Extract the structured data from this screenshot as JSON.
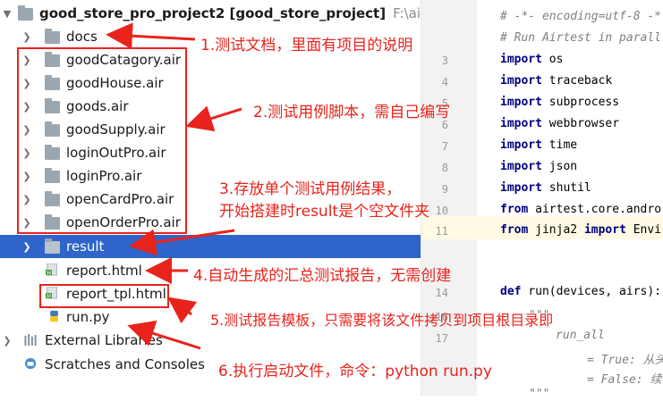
{
  "project": {
    "name": "good_store_pro_project2",
    "module": "[good_store_project]",
    "path": "F:\\airtest"
  },
  "tree": [
    {
      "label": "docs",
      "type": "folder"
    },
    {
      "label": "goodCatagory.air",
      "type": "folder"
    },
    {
      "label": "goodHouse.air",
      "type": "folder"
    },
    {
      "label": "goods.air",
      "type": "folder"
    },
    {
      "label": "goodSupply.air",
      "type": "folder"
    },
    {
      "label": "loginOutPro.air",
      "type": "folder"
    },
    {
      "label": "loginPro.air",
      "type": "folder"
    },
    {
      "label": "openCardPro.air",
      "type": "folder"
    },
    {
      "label": "openOrderPro.air",
      "type": "folder"
    },
    {
      "label": "result",
      "type": "folder",
      "selected": true
    },
    {
      "label": "report.html",
      "type": "html"
    },
    {
      "label": "report_tpl.html",
      "type": "html"
    },
    {
      "label": "run.py",
      "type": "python"
    },
    {
      "label": "External Libraries",
      "type": "library"
    },
    {
      "label": "Scratches and Consoles",
      "type": "scratch"
    }
  ],
  "annotations": {
    "a1": "1.测试文档，里面有项目的说明",
    "a2": "2.测试用例脚本，需自己编写",
    "a3_line1": "3.存放单个测试用例结果，",
    "a3_line2": "开始搭建时result是个空文件夹",
    "a4": "4.自动生成的汇总测试报告，无需创建",
    "a5": "5.测试报告模板，只需要将该文件拷贝到项目根目录即",
    "a6": "6.执行启动文件，命令：python run.py"
  },
  "editor": {
    "line_numbers": [
      "3",
      "4",
      "5",
      "6",
      "7",
      "8",
      "9",
      "10",
      "11",
      "14",
      "16",
      "17"
    ],
    "lines": {
      "c1": "# -*- encoding=utf-8 -*-",
      "c2": "# Run Airtest in parall",
      "l3_kw": "import",
      "l3": " os",
      "l4_kw": "import",
      "l4": " traceback",
      "l5_kw": "import",
      "l5": " subprocess",
      "l6_kw": "import",
      "l6": " webbrowser",
      "l7_kw": "import",
      "l7": " time",
      "l8_kw": "import",
      "l8": " json",
      "l9_kw": "import",
      "l9": " shutil",
      "l10_kw": "from",
      "l10": " airtest.core.andro",
      "l11_kw": "from",
      "l11a": " jinja2 ",
      "l11_kw2": "import",
      "l11b": " Envi",
      "l14_kw": "def",
      "l14": " run(devices, airs):",
      "doc1": "\"\"\"",
      "doc2": "run_all",
      "doc3": "= True: 从头",
      "doc4": "= False: 续",
      "doc5": "\"\"\""
    }
  },
  "colors": {
    "accent": "#2f65ca",
    "annotation": "#e8231c",
    "folder": "#9aa7b0"
  }
}
